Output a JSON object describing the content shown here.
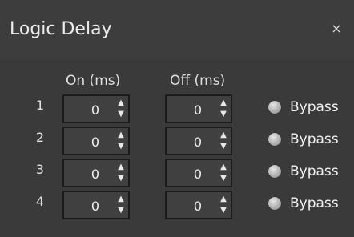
{
  "window": {
    "title": "Logic Delay",
    "close_glyph": "×"
  },
  "headers": {
    "on": "On (ms)",
    "off": "Off (ms)"
  },
  "rows": [
    {
      "index": "1",
      "on_value": "0",
      "off_value": "0",
      "bypass_label": "Bypass"
    },
    {
      "index": "2",
      "on_value": "0",
      "off_value": "0",
      "bypass_label": "Bypass"
    },
    {
      "index": "3",
      "on_value": "0",
      "off_value": "0",
      "bypass_label": "Bypass"
    },
    {
      "index": "4",
      "on_value": "0",
      "off_value": "0",
      "bypass_label": "Bypass"
    }
  ],
  "icons": {
    "up": "▲",
    "down": "▼"
  }
}
